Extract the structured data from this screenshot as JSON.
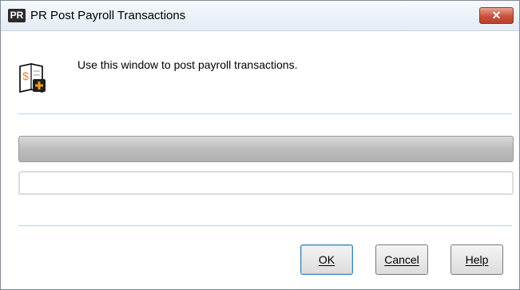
{
  "window": {
    "app_icon_text": "PR",
    "title": "PR Post Payroll Transactions",
    "close_glyph": "✕"
  },
  "header": {
    "icon": "ledger-post-icon",
    "instructions": "Use this window to post payroll transactions."
  },
  "progress": {
    "fraction": 1.0
  },
  "status": {
    "value": ""
  },
  "buttons": {
    "ok_label": "OK",
    "cancel_label": "Cancel",
    "help_label": "Help"
  },
  "colors": {
    "close_button": "#c9503a",
    "separator": "#b9d3ea",
    "progress_fill": "#bdbdbd",
    "default_button_border": "#3c7fb1"
  }
}
